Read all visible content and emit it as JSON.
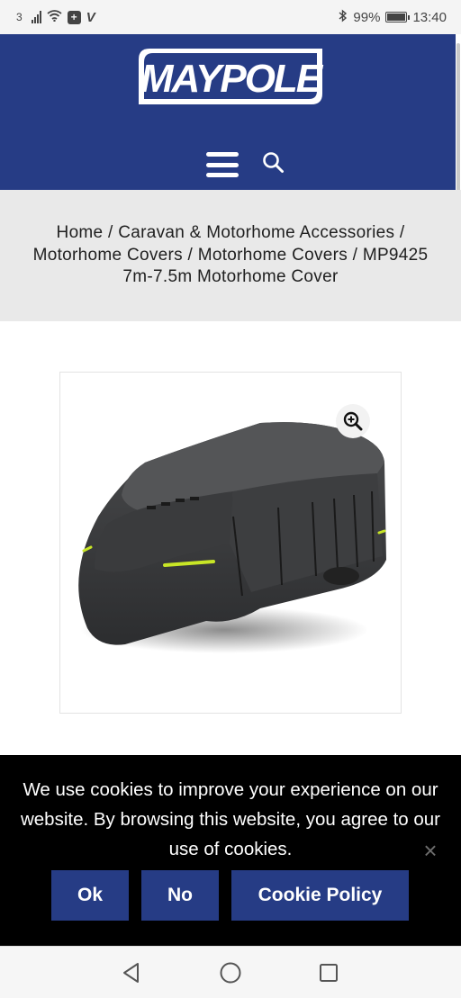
{
  "status_bar": {
    "carrier": "3",
    "plus_badge": "+",
    "v_badge": "V",
    "battery_text": "99%",
    "battery_level": 0.99,
    "time": "13:40"
  },
  "header": {
    "logo_text": "MAYPOLE",
    "background_color": "#263c85",
    "menu_icon": "hamburger-menu-icon",
    "search_icon": "search-icon"
  },
  "breadcrumb": {
    "separator": " / ",
    "items": [
      "Home",
      "Caravan & Motorhome Accessories",
      "Motorhome Covers",
      "Motorhome Covers"
    ],
    "current": "MP9425 7m-7.5m Motorhome Cover"
  },
  "product": {
    "zoom_icon": "zoom-in-icon"
  },
  "cookie_banner": {
    "message": "We use cookies to improve your experience on our website. By browsing this website, you agree to our use of cookies.",
    "close_symbol": "×",
    "buttons": {
      "ok": "Ok",
      "no": "No",
      "policy": "Cookie Policy"
    },
    "button_color": "#263c85"
  },
  "nav_bar": {
    "icons": [
      "back-triangle-icon",
      "home-circle-icon",
      "recents-square-icon"
    ]
  }
}
